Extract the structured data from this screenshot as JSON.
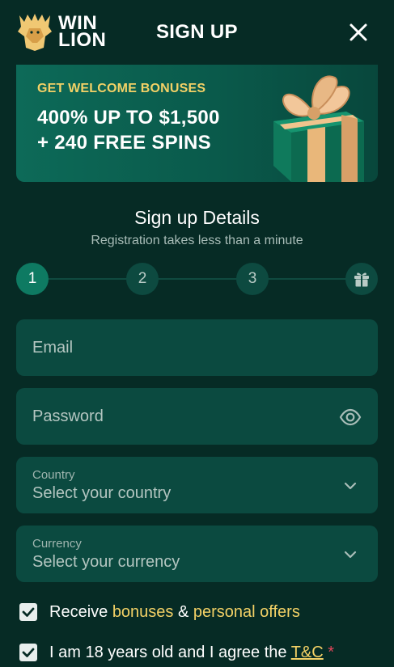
{
  "header": {
    "logo_line1": "WIN",
    "logo_line2": "LION",
    "title": "SIGN UP"
  },
  "banner": {
    "kicker": "GET WELCOME BONUSES",
    "line1": "400% UP TO $1,500",
    "line2": "+ 240 FREE SPINS"
  },
  "details": {
    "title": "Sign up Details",
    "subtitle": "Registration takes less than a minute"
  },
  "steps": [
    "1",
    "2",
    "3"
  ],
  "current_step": 1,
  "form": {
    "email_placeholder": "Email",
    "password_placeholder": "Password",
    "country_label": "Country",
    "country_value": "Select your country",
    "currency_label": "Currency",
    "currency_value": "Select your currency"
  },
  "checks": {
    "receive_prefix": "Receive ",
    "receive_bonuses": "bonuses",
    "receive_amp": " & ",
    "receive_offers": "personal offers",
    "age_prefix": "I am 18 years old and I agree the ",
    "age_tc": "T&C",
    "age_required": "*"
  },
  "colors": {
    "background": "#062b25",
    "field": "#0b4a40",
    "accent_gold": "#f3d166",
    "active_step": "#0e7a62",
    "required": "#e0455a"
  },
  "icons": {
    "close": "close-icon",
    "lion_logo": "lion-logo-icon",
    "gift_step": "gift-icon",
    "password_visibility": "eye-icon",
    "dropdown": "chevron-down-icon",
    "checkbox": "checkmark-icon"
  }
}
